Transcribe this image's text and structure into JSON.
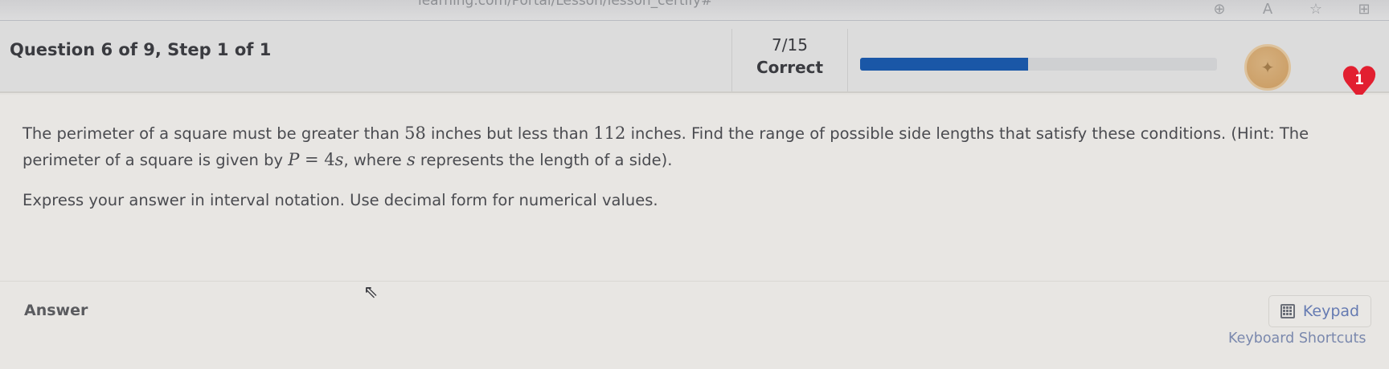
{
  "browser": {
    "url_fragment": "learning.com/Portal/Lesson/lesson_certify#",
    "icons": [
      "zoom-icon",
      "read-aloud-icon",
      "favorites-icon",
      "collections-icon"
    ]
  },
  "header": {
    "question_title": "Question 6 of 9, Step 1 of 1",
    "score": "7/15",
    "score_status": "Correct",
    "progress_fraction": 0.47,
    "progress_color": "#1a57a7",
    "lives": "1",
    "heart_color": "#e21f30"
  },
  "problem": {
    "text_1": "The perimeter of a square must be greater than ",
    "num_1": "58",
    "text_2": " inches but less than ",
    "num_2": "112",
    "text_3": " inches.  Find the range of possible side lengths that satisfy these conditions.  (Hint: The perimeter of a square is given by ",
    "formula_P": "P",
    "formula_eq": " = 4",
    "formula_s": "s",
    "text_4": ", where ",
    "var_s": "s",
    "text_5": " represents the length of a side).",
    "instructions": "Express your answer in interval notation.  Use decimal form for numerical values."
  },
  "answer": {
    "label": "Answer",
    "keypad_label": "Keypad",
    "shortcuts_label": "Keyboard Shortcuts"
  }
}
